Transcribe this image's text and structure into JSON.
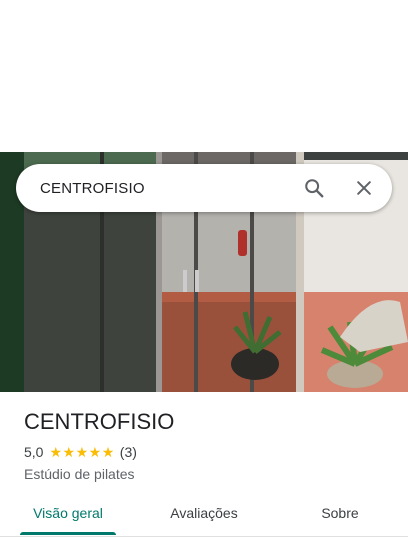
{
  "search": {
    "query": "CENTROFISIO"
  },
  "place": {
    "name": "CENTROFISIO",
    "rating": "5,0",
    "stars": 5,
    "review_count": "(3)",
    "category": "Estúdio de pilates"
  },
  "tabs": [
    {
      "label": "Visão geral",
      "active": true
    },
    {
      "label": "Avaliações",
      "active": false
    },
    {
      "label": "Sobre",
      "active": false
    }
  ],
  "colors": {
    "accent": "#00796b",
    "star": "#fbbc04"
  }
}
